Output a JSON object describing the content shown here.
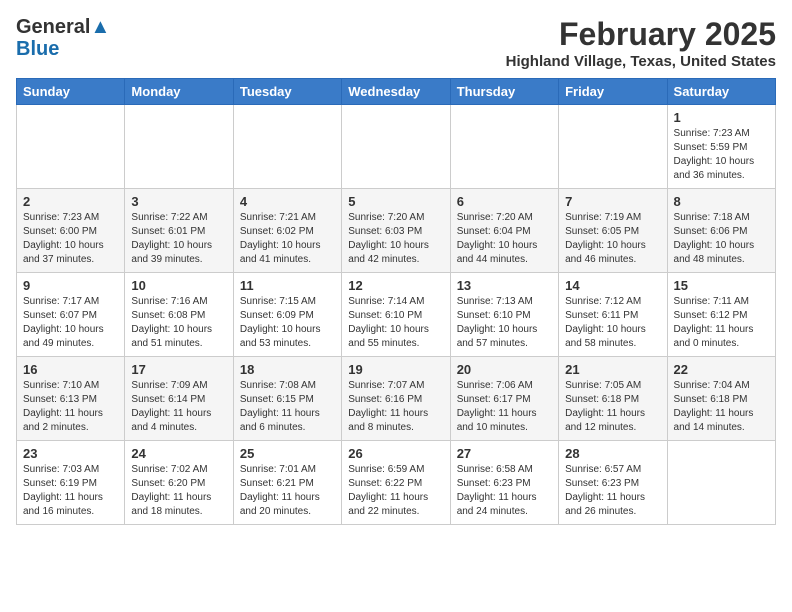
{
  "header": {
    "logo_line1": "General",
    "logo_line2": "Blue",
    "month_year": "February 2025",
    "location": "Highland Village, Texas, United States"
  },
  "weekdays": [
    "Sunday",
    "Monday",
    "Tuesday",
    "Wednesday",
    "Thursday",
    "Friday",
    "Saturday"
  ],
  "weeks": [
    [
      {
        "day": "",
        "info": ""
      },
      {
        "day": "",
        "info": ""
      },
      {
        "day": "",
        "info": ""
      },
      {
        "day": "",
        "info": ""
      },
      {
        "day": "",
        "info": ""
      },
      {
        "day": "",
        "info": ""
      },
      {
        "day": "1",
        "info": "Sunrise: 7:23 AM\nSunset: 5:59 PM\nDaylight: 10 hours and 36 minutes."
      }
    ],
    [
      {
        "day": "2",
        "info": "Sunrise: 7:23 AM\nSunset: 6:00 PM\nDaylight: 10 hours and 37 minutes."
      },
      {
        "day": "3",
        "info": "Sunrise: 7:22 AM\nSunset: 6:01 PM\nDaylight: 10 hours and 39 minutes."
      },
      {
        "day": "4",
        "info": "Sunrise: 7:21 AM\nSunset: 6:02 PM\nDaylight: 10 hours and 41 minutes."
      },
      {
        "day": "5",
        "info": "Sunrise: 7:20 AM\nSunset: 6:03 PM\nDaylight: 10 hours and 42 minutes."
      },
      {
        "day": "6",
        "info": "Sunrise: 7:20 AM\nSunset: 6:04 PM\nDaylight: 10 hours and 44 minutes."
      },
      {
        "day": "7",
        "info": "Sunrise: 7:19 AM\nSunset: 6:05 PM\nDaylight: 10 hours and 46 minutes."
      },
      {
        "day": "8",
        "info": "Sunrise: 7:18 AM\nSunset: 6:06 PM\nDaylight: 10 hours and 48 minutes."
      }
    ],
    [
      {
        "day": "9",
        "info": "Sunrise: 7:17 AM\nSunset: 6:07 PM\nDaylight: 10 hours and 49 minutes."
      },
      {
        "day": "10",
        "info": "Sunrise: 7:16 AM\nSunset: 6:08 PM\nDaylight: 10 hours and 51 minutes."
      },
      {
        "day": "11",
        "info": "Sunrise: 7:15 AM\nSunset: 6:09 PM\nDaylight: 10 hours and 53 minutes."
      },
      {
        "day": "12",
        "info": "Sunrise: 7:14 AM\nSunset: 6:10 PM\nDaylight: 10 hours and 55 minutes."
      },
      {
        "day": "13",
        "info": "Sunrise: 7:13 AM\nSunset: 6:10 PM\nDaylight: 10 hours and 57 minutes."
      },
      {
        "day": "14",
        "info": "Sunrise: 7:12 AM\nSunset: 6:11 PM\nDaylight: 10 hours and 58 minutes."
      },
      {
        "day": "15",
        "info": "Sunrise: 7:11 AM\nSunset: 6:12 PM\nDaylight: 11 hours and 0 minutes."
      }
    ],
    [
      {
        "day": "16",
        "info": "Sunrise: 7:10 AM\nSunset: 6:13 PM\nDaylight: 11 hours and 2 minutes."
      },
      {
        "day": "17",
        "info": "Sunrise: 7:09 AM\nSunset: 6:14 PM\nDaylight: 11 hours and 4 minutes."
      },
      {
        "day": "18",
        "info": "Sunrise: 7:08 AM\nSunset: 6:15 PM\nDaylight: 11 hours and 6 minutes."
      },
      {
        "day": "19",
        "info": "Sunrise: 7:07 AM\nSunset: 6:16 PM\nDaylight: 11 hours and 8 minutes."
      },
      {
        "day": "20",
        "info": "Sunrise: 7:06 AM\nSunset: 6:17 PM\nDaylight: 11 hours and 10 minutes."
      },
      {
        "day": "21",
        "info": "Sunrise: 7:05 AM\nSunset: 6:18 PM\nDaylight: 11 hours and 12 minutes."
      },
      {
        "day": "22",
        "info": "Sunrise: 7:04 AM\nSunset: 6:18 PM\nDaylight: 11 hours and 14 minutes."
      }
    ],
    [
      {
        "day": "23",
        "info": "Sunrise: 7:03 AM\nSunset: 6:19 PM\nDaylight: 11 hours and 16 minutes."
      },
      {
        "day": "24",
        "info": "Sunrise: 7:02 AM\nSunset: 6:20 PM\nDaylight: 11 hours and 18 minutes."
      },
      {
        "day": "25",
        "info": "Sunrise: 7:01 AM\nSunset: 6:21 PM\nDaylight: 11 hours and 20 minutes."
      },
      {
        "day": "26",
        "info": "Sunrise: 6:59 AM\nSunset: 6:22 PM\nDaylight: 11 hours and 22 minutes."
      },
      {
        "day": "27",
        "info": "Sunrise: 6:58 AM\nSunset: 6:23 PM\nDaylight: 11 hours and 24 minutes."
      },
      {
        "day": "28",
        "info": "Sunrise: 6:57 AM\nSunset: 6:23 PM\nDaylight: 11 hours and 26 minutes."
      },
      {
        "day": "",
        "info": ""
      }
    ]
  ]
}
